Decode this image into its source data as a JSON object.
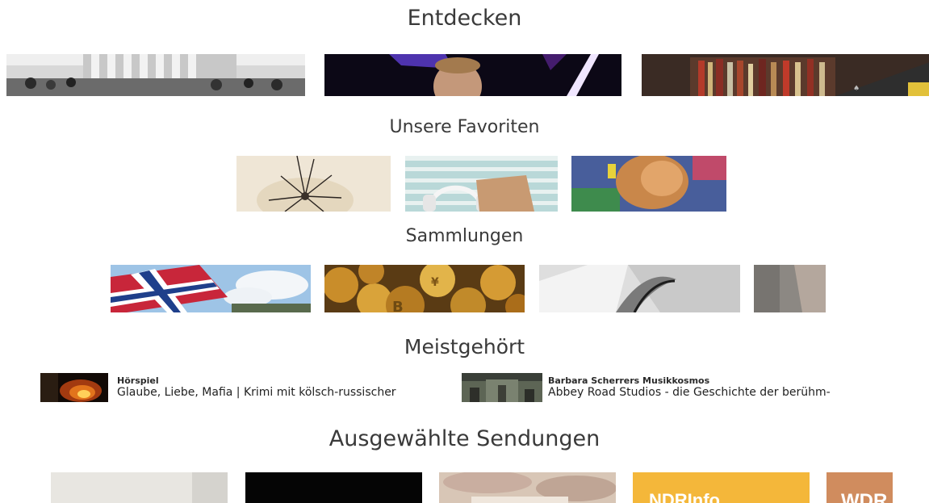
{
  "sections": {
    "entdecken": {
      "title": "Entdecken"
    },
    "favoriten": {
      "title": "Unsere Favoriten"
    },
    "sammlungen": {
      "title": "Sammlungen"
    },
    "meistgehoert": {
      "title": "Meistgehört",
      "items": [
        {
          "kicker": "Hörspiel",
          "title": "Glaube, Liebe, Mafia | Krimi mit kölsch-russischer"
        },
        {
          "kicker": "Barbara Scherrers Musikkosmos",
          "title": "Abbey Road Studios - die Geschichte der berühm-"
        }
      ]
    },
    "ausgewaehlt": {
      "title": "Ausgewählte Sendungen",
      "logos": {
        "ndr": "NDRInfo",
        "wdr": "WDR"
      }
    }
  },
  "colors": {
    "ndr_yellow": "#f4b73a",
    "wdr_orange": "#d08c5e",
    "title_text": "#3a3a3a"
  }
}
